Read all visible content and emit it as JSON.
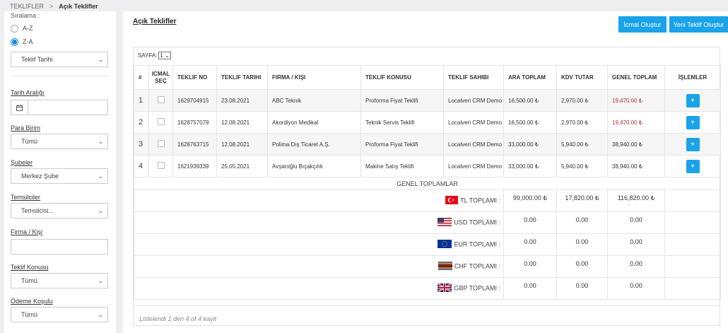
{
  "breadcrumb": {
    "root": "TEKLIFLER",
    "separator": ">",
    "current": "Açık Teklifler"
  },
  "sidebar": {
    "sort_title": "Sıralama :",
    "sort_options": [
      {
        "label": "A-Z",
        "checked": false
      },
      {
        "label": "Z-A",
        "checked": true
      }
    ],
    "sort_field": "Teklif Tarihi",
    "filters": {
      "date_range": {
        "label": "Tarih Aralığı",
        "value": ""
      },
      "currency": {
        "label": "Para Birim",
        "value": "Tümü"
      },
      "branches": {
        "label": "Şubeler",
        "value": "Merkez Şube"
      },
      "representatives": {
        "label": "Temsilciler",
        "value": "Temsilcisi..."
      },
      "company": {
        "label": "Firma / Kişi",
        "value": ""
      },
      "subject": {
        "label": "Teklif Konusu",
        "value": "Tümü"
      },
      "payment": {
        "label": "Ödeme Koşulu",
        "value": "Tümü"
      }
    }
  },
  "main": {
    "title": "Açık Teklifler",
    "btn_summary": "İcmal Oluştur",
    "btn_new": "Yeni Teklif Oluştur",
    "pager_label": "SAYFA:",
    "pager_value": "1",
    "columns": [
      "#",
      "ICMAL SEÇ",
      "TEKLIF NO",
      "TEKLIF TARIHI",
      "FIRMA / KIŞI",
      "TEKLIF KONUSU",
      "TEKLIF SAHIBI",
      "ARA TOPLAM",
      "KDV TUTAR",
      "GENEL TOPLAM",
      "İŞLEMLER"
    ],
    "rows": [
      {
        "idx": "1",
        "no": "1629704915",
        "date": "23.08.2021",
        "firm": "ABC Teknik",
        "subject": "Proforma Fiyat Teklifi",
        "owner": "Localveri CRM Demo",
        "subtotal": "16,500.00 ₺",
        "vat": "2,970.00 ₺",
        "total": "19,470.00 ₺"
      },
      {
        "idx": "2",
        "no": "1628757079",
        "date": "12.08.2021",
        "firm": "Akordiyon Medikal",
        "subject": "Teknik Servis Teklifi",
        "owner": "Localveri CRM Demo",
        "subtotal": "16,500.00 ₺",
        "vat": "2,970.00 ₺",
        "total": "19,470.00 ₺"
      },
      {
        "idx": "3",
        "no": "1628763715",
        "date": "12.08.2021",
        "firm": "Polima Dış Ticaret A.Ş.",
        "subject": "Proforma Fiyat Teklifi",
        "owner": "Localveri CRM Demo",
        "subtotal": "33,000.00 ₺",
        "vat": "5,940.00 ₺",
        "total": "38,940.00 ₺"
      },
      {
        "idx": "4",
        "no": "1621939339",
        "date": "25.05.2021",
        "firm": "Avşaroğlu Bıçakçılık",
        "subject": "Makine Satış Teklifi",
        "owner": "Localveri CRM Demo",
        "subtotal": "33,000.00 ₺",
        "vat": "5,940.00 ₺",
        "total": "38,940.00 ₺"
      }
    ],
    "grand_totals_title": "GENEL TOPLAMLAR",
    "totals": [
      {
        "label": "TL TOPLAMI :",
        "flag": "turkey-flag-icon",
        "subtotal": "99,000.00 ₺",
        "vat": "17,820.00 ₺",
        "total": "116,820.00 ₺"
      },
      {
        "label": "USD TOPLAMI :",
        "flag": "usa-flag-icon",
        "subtotal": "0.00",
        "vat": "0.00",
        "total": "0.00"
      },
      {
        "label": "EUR TOPLAMI :",
        "flag": "eu-flag-icon",
        "subtotal": "0.00",
        "vat": "0.00",
        "total": "0.00"
      },
      {
        "label": "CHF TOPLAMI :",
        "flag": "swiss-flag-icon",
        "subtotal": "0.00",
        "vat": "0.00",
        "total": "0.00"
      },
      {
        "label": "GBP TOPLAMI :",
        "flag": "uk-flag-icon",
        "subtotal": "0.00",
        "vat": "0.00",
        "total": "0.00"
      }
    ],
    "footer": "Listelendi 1 den 4 of 4 kayit"
  },
  "colors": {
    "accent": "#1aa3e8",
    "grand_total_red": "#b03030"
  }
}
